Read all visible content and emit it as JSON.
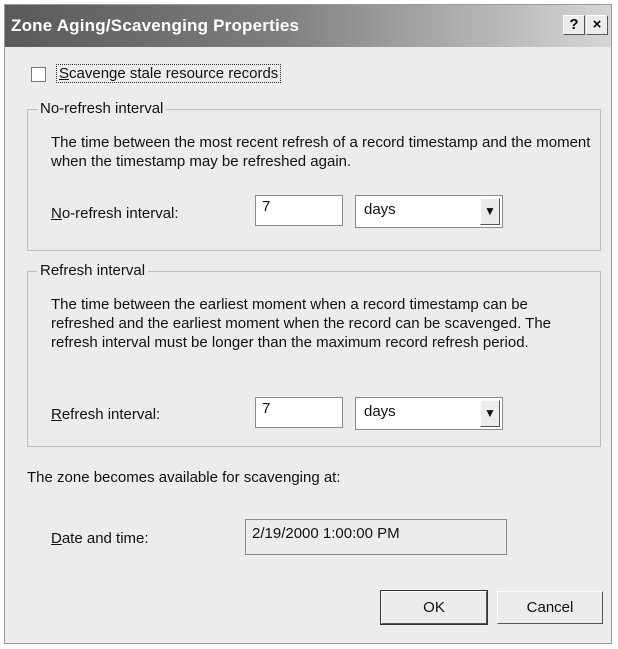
{
  "window": {
    "title": "Zone Aging/Scavenging Properties",
    "help_label": "?",
    "close_label": "×"
  },
  "scavenge": {
    "checked": false,
    "label_first": "S",
    "label_rest": "cavenge stale resource records"
  },
  "no_refresh": {
    "group_title": "No-refresh interval",
    "description": "The time between the most recent refresh of a record timestamp and the moment when the timestamp may be refreshed again.",
    "field_label_first": "N",
    "field_label_rest": "o-refresh interval:",
    "value": "7",
    "unit": "days"
  },
  "refresh": {
    "group_title": "Refresh interval",
    "description": "The time between the earliest moment when a record timestamp can be refreshed and the earliest moment when the record can be scavenged. The refresh interval must be longer than the maximum record refresh period.",
    "field_label_first": "R",
    "field_label_rest": "efresh interval:",
    "value": "7",
    "unit": "days"
  },
  "availability": {
    "text": "The zone becomes available for scavenging at:",
    "date_label_first": "D",
    "date_label_rest": "ate and time:",
    "date_value": "2/19/2000 1:00:00 PM"
  },
  "buttons": {
    "ok": "OK",
    "cancel": "Cancel"
  }
}
